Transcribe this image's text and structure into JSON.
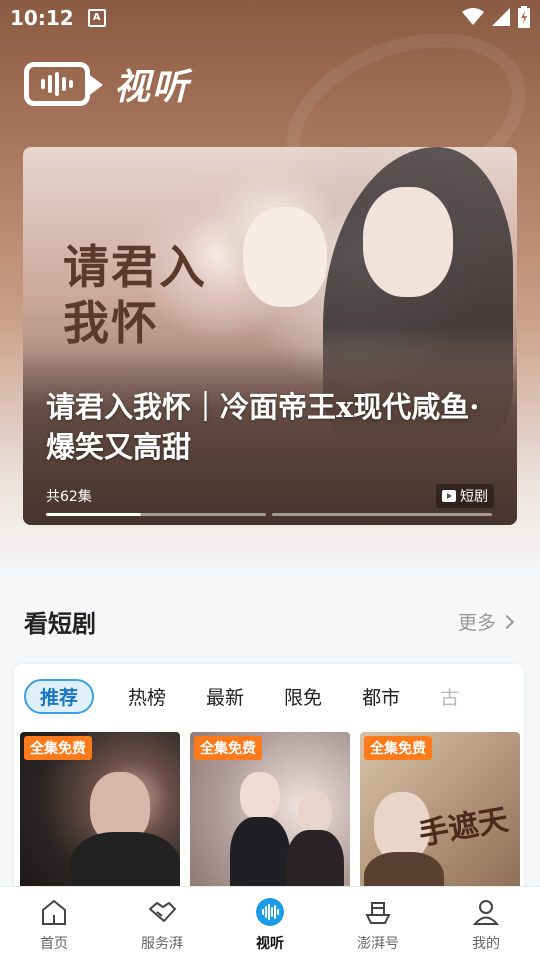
{
  "status_bar": {
    "time": "10:12",
    "indicator": "A"
  },
  "header": {
    "app_title": "视听"
  },
  "banner": {
    "artwork_text": "请君入我怀",
    "title": "请君入我怀｜冷面帝王x现代咸鱼·爆笑又高甜",
    "episodes": "共62集",
    "tag": "短剧",
    "slide_progress": 0.43
  },
  "section": {
    "title": "看短剧",
    "more_label": "更多",
    "tabs": [
      {
        "label": "推荐",
        "active": true
      },
      {
        "label": "热榜"
      },
      {
        "label": "最新"
      },
      {
        "label": "限免"
      },
      {
        "label": "都市"
      },
      {
        "label": "古"
      }
    ],
    "posters": [
      {
        "badge": "全集免费"
      },
      {
        "badge": "全集免费"
      },
      {
        "badge": "全集免费",
        "artwork_text": "手遮天"
      }
    ]
  },
  "tabbar": {
    "items": [
      {
        "label": "首页",
        "icon": "home-icon"
      },
      {
        "label": "服务湃",
        "icon": "handshake-icon"
      },
      {
        "label": "视听",
        "icon": "audio-wave-icon",
        "active": true
      },
      {
        "label": "澎湃号",
        "icon": "boat-icon"
      },
      {
        "label": "我的",
        "icon": "user-icon"
      }
    ]
  },
  "colors": {
    "accent": "#1a78c2",
    "badge": "#ff7a1a"
  }
}
